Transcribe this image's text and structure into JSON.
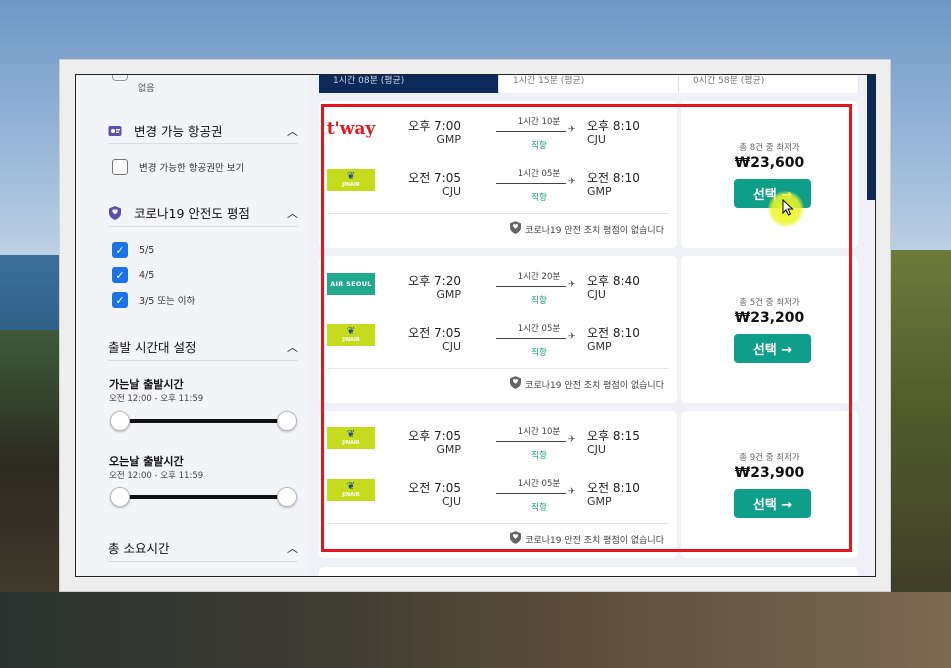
{
  "filters": {
    "prev_option": "없음",
    "changeable": {
      "title": "변경 가능 항공권",
      "checkbox_label": "변경 가능한 항공권만 보기"
    },
    "covid": {
      "title": "코로나19 안전도 평점",
      "options": [
        "5/5",
        "4/5",
        "3/5 또는 이하"
      ]
    },
    "departure_time": {
      "title": "출발 시간대 설정",
      "outbound_label": "가는날 출발시간",
      "outbound_range": "오전 12:00 - 오후 11:59",
      "return_label": "오는날 출발시간",
      "return_range": "오전 12:00 - 오후 11:59"
    },
    "duration": {
      "title": "총 소요시간"
    }
  },
  "tabs": [
    "1시간 08분 (평균)",
    "1시간 15분 (평균)",
    "0시간 58분 (평균)"
  ],
  "results": [
    {
      "outbound": {
        "airline": "t'way",
        "dep_time": "오후 7:00",
        "dep_ap": "GMP",
        "duration": "1시간 10분",
        "direct": "직항",
        "arr_time": "오후 8:10",
        "arr_ap": "CJU"
      },
      "inbound": {
        "airline": "JINAIR",
        "dep_time": "오전 7:05",
        "dep_ap": "CJU",
        "duration": "1시간 05분",
        "direct": "직항",
        "arr_time": "오전 8:10",
        "arr_ap": "GMP"
      },
      "safety": "코로나19 안전 조치 평점이 없습니다",
      "lowest": "총 8건 중 최저가",
      "price": "₩23,600",
      "select": "선택 →"
    },
    {
      "outbound": {
        "airline": "AIR SEOUL",
        "dep_time": "오후 7:20",
        "dep_ap": "GMP",
        "duration": "1시간 20분",
        "direct": "직항",
        "arr_time": "오후 8:40",
        "arr_ap": "CJU"
      },
      "inbound": {
        "airline": "JINAIR",
        "dep_time": "오전 7:05",
        "dep_ap": "CJU",
        "duration": "1시간 05분",
        "direct": "직항",
        "arr_time": "오전 8:10",
        "arr_ap": "GMP"
      },
      "safety": "코로나19 안전 조치 평점이 없습니다",
      "lowest": "총 5건 중 최저가",
      "price": "₩23,200",
      "select": "선택 →"
    },
    {
      "outbound": {
        "airline": "JINAIR",
        "dep_time": "오후 7:05",
        "dep_ap": "GMP",
        "duration": "1시간 10분",
        "direct": "직항",
        "arr_time": "오후 8:15",
        "arr_ap": "CJU"
      },
      "inbound": {
        "airline": "JINAIR",
        "dep_time": "오전 7:05",
        "dep_ap": "CJU",
        "duration": "1시간 05분",
        "direct": "직항",
        "arr_time": "오전 8:10",
        "arr_ap": "GMP"
      },
      "safety": "코로나19 안전 조치 평점이 없습니다",
      "lowest": "총 9건 중 최저가",
      "price": "₩23,900",
      "select": "선택 →"
    }
  ],
  "colors": {
    "accent": "#0f9e8a",
    "highlight": "#e8141b",
    "checkbox": "#1a73e8",
    "nav_dark": "#0b2a5a"
  }
}
